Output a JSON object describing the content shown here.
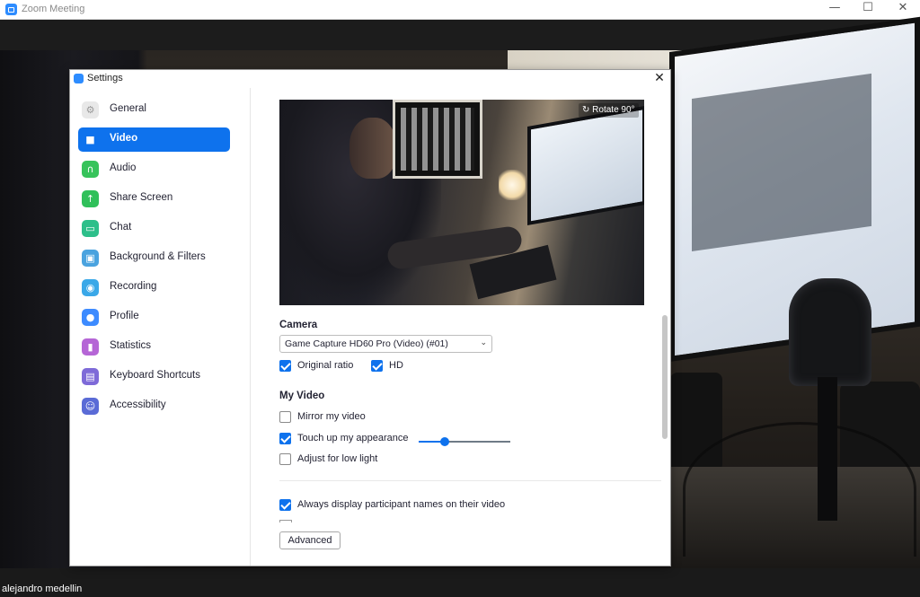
{
  "window": {
    "title": "Zoom Meeting",
    "minimize": "—",
    "maximize": "☐",
    "close": "✕"
  },
  "meeting": {
    "participant_name": "alejandro medellin"
  },
  "settings": {
    "title": "Settings",
    "close": "✕",
    "nav": [
      {
        "label": "General",
        "icon": "gear-icon",
        "color": "#e8e8e8",
        "active": false
      },
      {
        "label": "Video",
        "icon": "video-camera-icon",
        "color": "#0e72ed",
        "active": true
      },
      {
        "label": "Audio",
        "icon": "headphones-icon",
        "color": "#37c35b",
        "active": false
      },
      {
        "label": "Share Screen",
        "icon": "share-screen-icon",
        "color": "#30c05a",
        "active": false
      },
      {
        "label": "Chat",
        "icon": "chat-bubble-icon",
        "color": "#2dbf8a",
        "active": false
      },
      {
        "label": "Background & Filters",
        "icon": "background-filters-icon",
        "color": "#4aa3df",
        "active": false
      },
      {
        "label": "Recording",
        "icon": "recording-icon",
        "color": "#3aa8e8",
        "active": false
      },
      {
        "label": "Profile",
        "icon": "profile-icon",
        "color": "#3d8bff",
        "active": false
      },
      {
        "label": "Statistics",
        "icon": "statistics-icon",
        "color": "#b566d6",
        "active": false
      },
      {
        "label": "Keyboard Shortcuts",
        "icon": "keyboard-icon",
        "color": "#7e6ad8",
        "active": false
      },
      {
        "label": "Accessibility",
        "icon": "accessibility-icon",
        "color": "#5a6bd6",
        "active": false
      }
    ],
    "video": {
      "rotate_label": "Rotate 90°",
      "camera_label": "Camera",
      "camera_selected": "Game Capture HD60 Pro (Video) (#01)",
      "original_ratio_label": "Original ratio",
      "original_ratio_checked": true,
      "hd_label": "HD",
      "hd_checked": true,
      "my_video_label": "My Video",
      "mirror_label": "Mirror my video",
      "mirror_checked": false,
      "touch_up_label": "Touch up my appearance",
      "touch_up_checked": true,
      "touch_up_level": 0.28,
      "low_light_label": "Adjust for low light",
      "low_light_checked": false,
      "always_display_label": "Always display participant names on their video",
      "always_display_checked": true,
      "advanced_label": "Advanced"
    }
  }
}
